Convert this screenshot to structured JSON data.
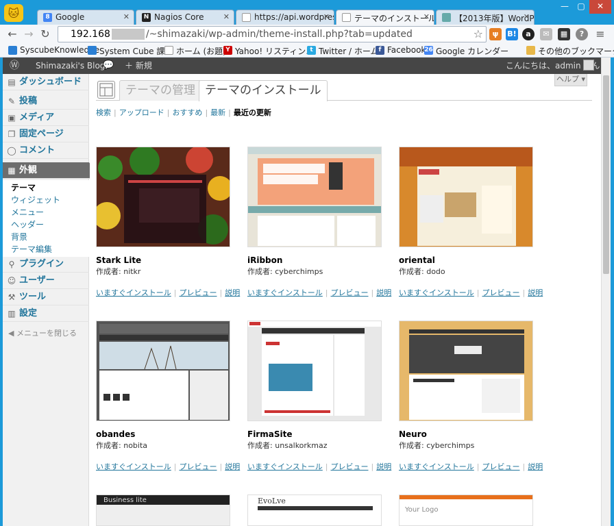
{
  "browser": {
    "tabs": [
      {
        "label": "Google",
        "icon": "google-icon",
        "color": "#4285f4"
      },
      {
        "label": "Nagios Core",
        "icon": "nagios-icon",
        "color": "#222"
      },
      {
        "label": "https://api.wordpress",
        "icon": "page-icon",
        "color": "#888"
      },
      {
        "label": "テーマのインストール",
        "icon": "page-icon",
        "color": "#888"
      },
      {
        "label": "【2013年版】WordPre",
        "icon": "page-icon",
        "color": "#6aa"
      }
    ],
    "url_host": "192.168",
    "url_path": "/~shimazaki/wp-admin/theme-install.php?tab=updated",
    "bookmarks": [
      {
        "label": "SyscubeKnowledge",
        "icon": "page-icon",
        "color": "#2a7fd4"
      },
      {
        "label": "System Cube 課題",
        "icon": "page-icon",
        "color": "#2a7fd4"
      },
      {
        "label": "ホーム (お題)",
        "icon": "page-icon",
        "color": "#999"
      },
      {
        "label": "Yahoo! リスティン…",
        "icon": "yahoo-icon",
        "color": "#c00"
      },
      {
        "label": "Twitter / ホーム",
        "icon": "twitter-icon",
        "color": "#29a9e1"
      },
      {
        "label": "Facebook",
        "icon": "facebook-icon",
        "color": "#3b5998"
      },
      {
        "label": "Google カレンダー",
        "icon": "calendar-icon",
        "color": "#4285f4"
      },
      {
        "label": "その他のブックマーク",
        "icon": "folder-icon",
        "color": "#e8b84a"
      }
    ],
    "ext_labels": [
      "B!",
      "a",
      "?"
    ]
  },
  "adminbar": {
    "site": "Shimazaki's Blog",
    "new_label": "新規",
    "greeting": "こんにちは、admin さん！"
  },
  "sidebar": {
    "items": [
      {
        "label": "ダッシュボード",
        "icon": "dashboard-icon"
      },
      {
        "label": "投稿",
        "icon": "pin-icon"
      },
      {
        "label": "メディア",
        "icon": "media-icon"
      },
      {
        "label": "固定ページ",
        "icon": "pages-icon"
      },
      {
        "label": "コメント",
        "icon": "comment-icon"
      },
      {
        "label": "外観",
        "icon": "appearance-icon"
      },
      {
        "label": "プラグイン",
        "icon": "plugin-icon"
      },
      {
        "label": "ユーザー",
        "icon": "users-icon"
      },
      {
        "label": "ツール",
        "icon": "tools-icon"
      },
      {
        "label": "設定",
        "icon": "settings-icon"
      }
    ],
    "submenu": [
      "テーマ",
      "ウィジェット",
      "メニュー",
      "ヘッダー",
      "背景",
      "テーマ編集"
    ],
    "collapse": "メニューを閉じる"
  },
  "header": {
    "help": "ヘルプ ▾",
    "tab_manage": "テーマの管理",
    "tab_install": "テーマのインストール"
  },
  "filters": [
    "検索",
    "アップロード",
    "おすすめ",
    "最新",
    "最近の更新"
  ],
  "theme_actions": {
    "install": "いますぐインストール",
    "preview": "プレビュー",
    "details": "説明"
  },
  "author_prefix": "作成者:",
  "themes": [
    {
      "name": "Stark Lite",
      "author": "nitkr"
    },
    {
      "name": "iRibbon",
      "author": "cyberchimps"
    },
    {
      "name": "oriental",
      "author": "dodo"
    },
    {
      "name": "obandes",
      "author": "nobita"
    },
    {
      "name": "FirmaSite",
      "author": "unsalkorkmaz"
    },
    {
      "name": "Neuro",
      "author": "cyberchimps"
    }
  ],
  "partial_themes": [
    "Business lite",
    "EvoLve",
    "Your Logo"
  ],
  "colors": {
    "link": "#21759b",
    "adminbar": "#464646",
    "chrome": "#1c9ad9"
  }
}
